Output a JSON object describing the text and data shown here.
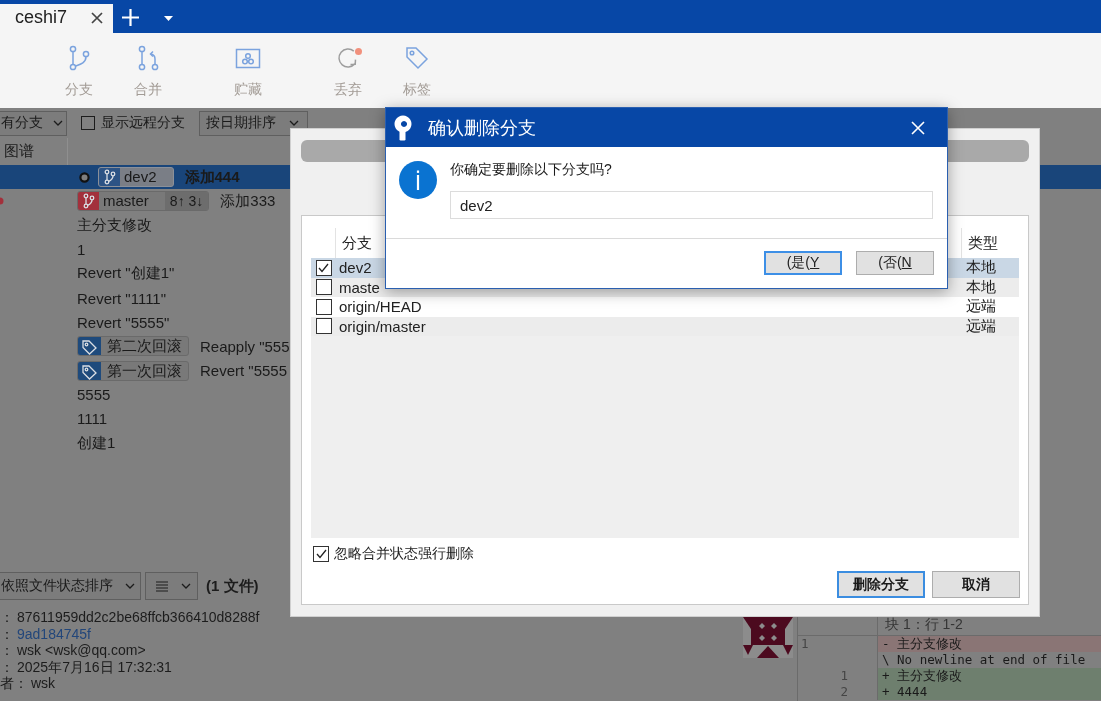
{
  "tab_bar": {
    "tabs": [
      {
        "label": "ceshi7",
        "selected": true
      }
    ]
  },
  "toolbar": {
    "groups": [
      {
        "buttons": [
          {
            "kind": "branch",
            "label": "分支",
            "indicator": false
          },
          {
            "kind": "merge",
            "label": "合并",
            "indicator": false
          }
        ]
      },
      {
        "buttons": [
          {
            "kind": "stash",
            "label": "贮藏",
            "indicator": false
          }
        ]
      },
      {
        "buttons": [
          {
            "kind": "discard",
            "label": "丢弃",
            "indicator": true
          },
          {
            "kind": "tag",
            "label": "标签",
            "indicator": false
          }
        ]
      }
    ]
  },
  "filter_bar": {
    "branch_filter": "有分支",
    "show_remote": {
      "label": "显示远程分支",
      "checked": false
    },
    "sort": "按日期排序"
  },
  "graph": {
    "column": "图谱",
    "commits": [
      {
        "selected": true,
        "head": true,
        "graph_dot": false,
        "refs": [
          {
            "kind": "branch",
            "name": "dev2",
            "color": "#2c5385"
          }
        ],
        "message": "添加444"
      },
      {
        "selected": false,
        "head": false,
        "graph_dot": true,
        "refs": [
          {
            "kind": "branch",
            "name": "master",
            "color": "#a3303c",
            "tracking": "8↑ 3↓"
          }
        ],
        "message": "添加333"
      },
      {
        "selected": false,
        "head": false,
        "graph_dot": false,
        "message": "主分支修改"
      },
      {
        "selected": false,
        "head": false,
        "graph_dot": false,
        "message": "1"
      },
      {
        "selected": false,
        "head": false,
        "graph_dot": false,
        "message": "Revert \"创建1\""
      },
      {
        "selected": false,
        "head": false,
        "graph_dot": false,
        "message": "Revert \"1111\""
      },
      {
        "selected": false,
        "head": false,
        "graph_dot": false,
        "message": "Revert \"5555\""
      },
      {
        "selected": false,
        "head": false,
        "graph_dot": false,
        "refs": [
          {
            "kind": "tag",
            "name": "第二次回滚",
            "color": "#1e4a7c"
          }
        ],
        "message": "Reapply \"555"
      },
      {
        "selected": false,
        "head": false,
        "graph_dot": false,
        "refs": [
          {
            "kind": "tag",
            "name": "第一次回滚",
            "color": "#1e4a7c"
          }
        ],
        "message": "Revert \"5555"
      },
      {
        "selected": false,
        "head": false,
        "graph_dot": false,
        "message": "5555"
      },
      {
        "selected": false,
        "head": false,
        "graph_dot": false,
        "message": "1111"
      },
      {
        "selected": false,
        "head": false,
        "graph_dot": false,
        "message": "创建1"
      }
    ]
  },
  "file_bar": {
    "sort": "依照文件状态排序",
    "count": "(1 文件)"
  },
  "details": [
    {
      "label": "：",
      "value": "87611959dd2c2be68ffcb366410d8288f",
      "kind": "text"
    },
    {
      "label": "：",
      "value": "9ad184745f",
      "kind": "link"
    },
    {
      "label": "：",
      "value": "wsk <wsk@qq.com>",
      "kind": "text"
    },
    {
      "label": "：",
      "value": "2025年7月16日 17:32:31",
      "kind": "text"
    },
    {
      "label": "者：",
      "value": "wsk",
      "kind": "text"
    }
  ],
  "diff": {
    "hunk_header": "块 1：行 1-2",
    "lines": [
      {
        "kind": "removed",
        "old_number": "1",
        "text": "- 主分支修改"
      },
      {
        "kind": "note",
        "text": "\\ No newline at end of file"
      },
      {
        "kind": "added",
        "new_number": "1",
        "text": "+ 主分支修改"
      },
      {
        "kind": "added",
        "new_number": "2",
        "text": "+ 4444"
      }
    ]
  },
  "delete_dialog": {
    "columns": [
      "分支",
      "类型"
    ],
    "branches": [
      {
        "name": "dev2",
        "type": "本地",
        "checked": true,
        "selected": true
      },
      {
        "name": "maste",
        "type": "本地",
        "checked": false,
        "selected": false
      },
      {
        "name": "origin/HEAD",
        "type": "远端",
        "checked": false,
        "selected": false
      },
      {
        "name": "origin/master",
        "type": "远端",
        "checked": false,
        "selected": false
      }
    ],
    "force_delete": {
      "label": "忽略合并状态强行删除",
      "checked": true
    },
    "buttons": [
      {
        "label": "删除分支",
        "default": true
      },
      {
        "label": "取消",
        "default": false
      }
    ]
  },
  "confirm_dialog": {
    "title": "确认删除分支",
    "message": "你确定要删除以下分支吗?",
    "field": {
      "value": "dev2"
    },
    "buttons": [
      {
        "label": "(是(",
        "mnemonic": "Y",
        "focused": true
      },
      {
        "label": "(否(",
        "mnemonic": "N",
        "focused": false
      }
    ]
  }
}
